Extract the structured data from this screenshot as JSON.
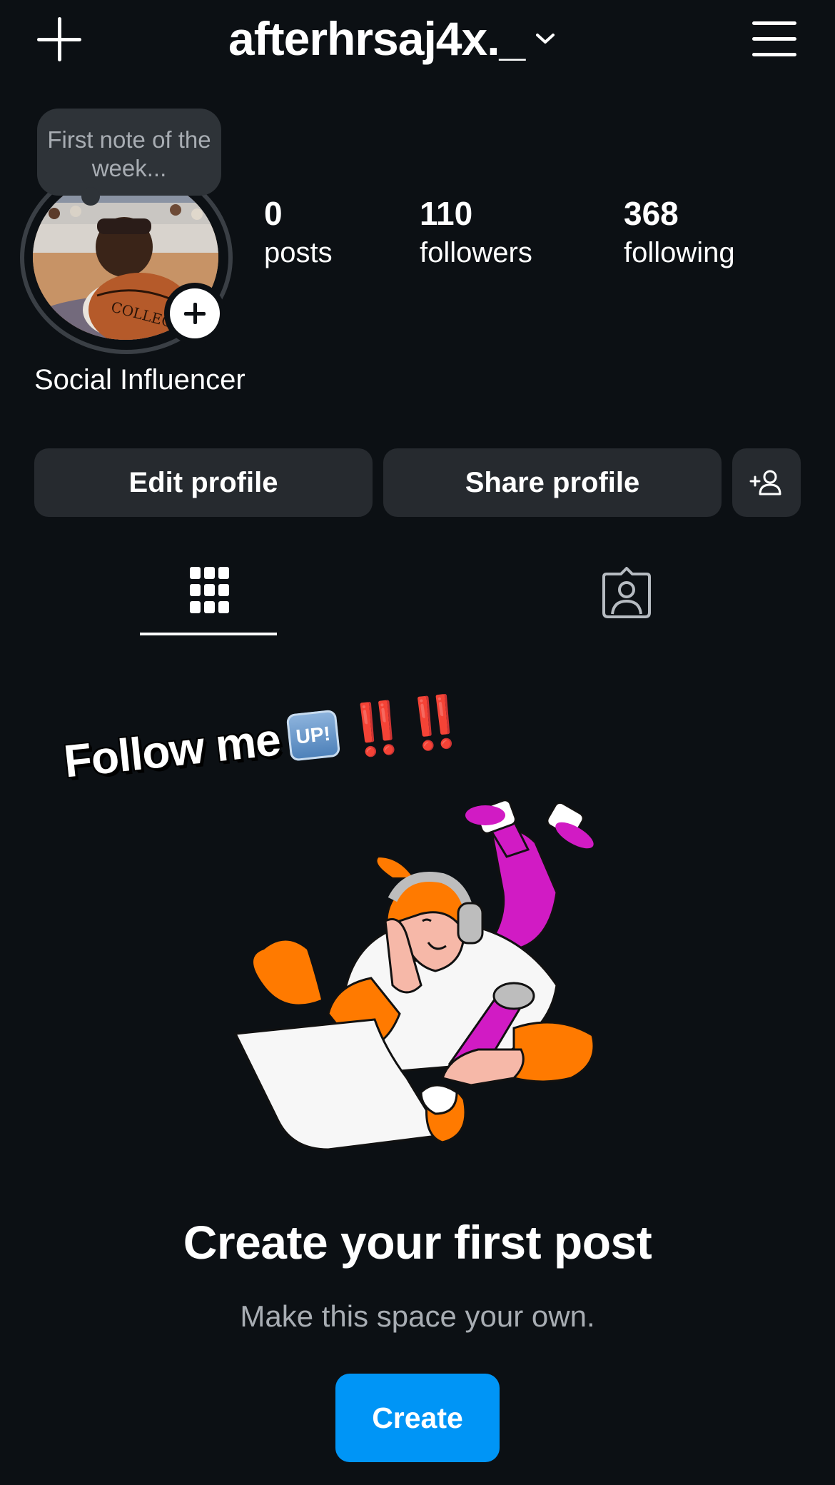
{
  "header": {
    "username": "afterhrsaj4x._",
    "new_icon": "plus-icon",
    "switch_icon": "chevron-down-icon",
    "menu_icon": "hamburger-menu-icon"
  },
  "profile": {
    "note": "First note of the week...",
    "stats": [
      {
        "value": "0",
        "label": "posts"
      },
      {
        "value": "110",
        "label": "followers"
      },
      {
        "value": "368",
        "label": "following"
      }
    ],
    "bio": "Social Influencer"
  },
  "actions": {
    "edit": "Edit profile",
    "share": "Share profile",
    "discover_icon": "add-person-icon"
  },
  "tabs": [
    {
      "name": "grid",
      "icon": "grid-icon",
      "active": true
    },
    {
      "name": "tagged",
      "icon": "tagged-person-icon",
      "active": false
    }
  ],
  "sticker": {
    "text": "Follow me",
    "badge": "UP!",
    "bangs": "‼️‼️"
  },
  "empty_state": {
    "title": "Create your first post",
    "subtitle": "Make this space your own.",
    "button": "Create"
  },
  "colors": {
    "background": "#0c1014",
    "button_bg": "#262a2f",
    "accent": "#0095f6"
  }
}
